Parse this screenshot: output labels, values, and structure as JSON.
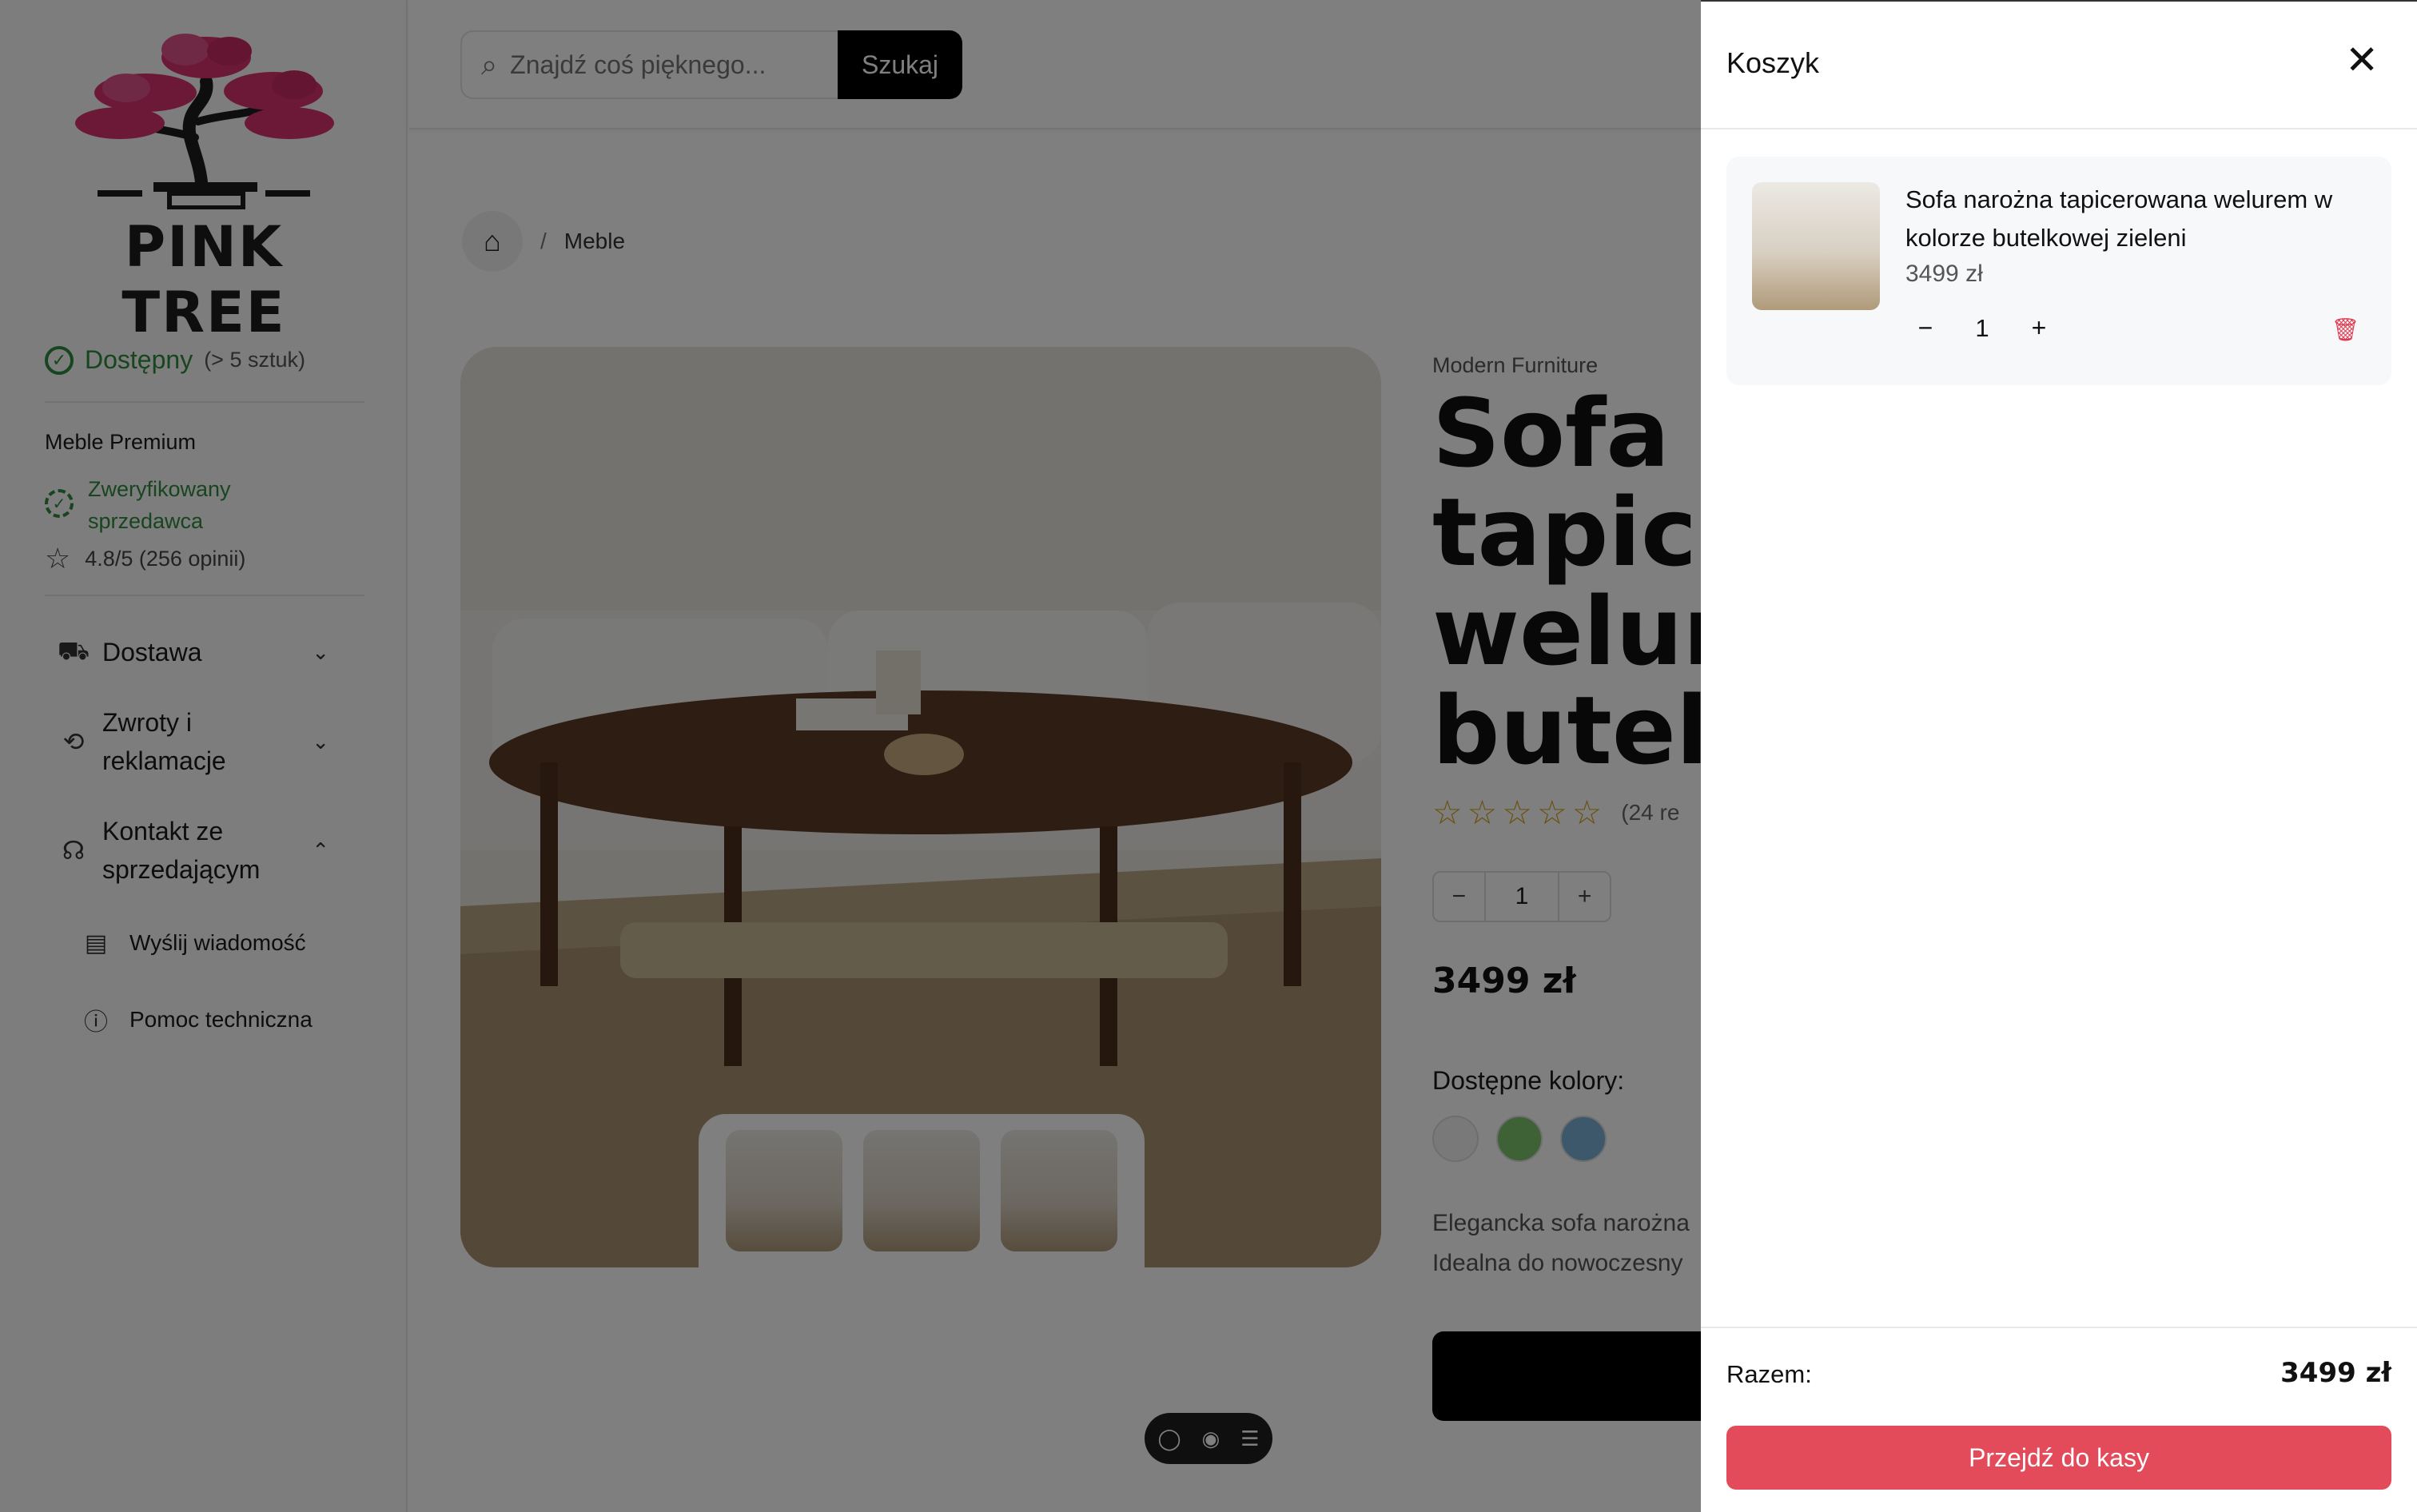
{
  "brand": {
    "logo_text": "PINK TREE"
  },
  "search": {
    "placeholder": "Znajdź coś pięknego...",
    "button_label": "Szukaj"
  },
  "breadcrumb": {
    "separator": "/",
    "current": "Meble"
  },
  "sidebar": {
    "availability": {
      "label": "Dostępny",
      "detail": "(> 5 sztuk)"
    },
    "seller": {
      "name": "Meble Premium",
      "verified_label": "Zweryfikowany sprzedawca",
      "rating": "4.8/5 (256 opinii)"
    },
    "accordion": [
      {
        "label": "Dostawa",
        "icon": "truck-icon",
        "expanded": false
      },
      {
        "label": "Zwroty i reklamacje",
        "icon": "returns-icon",
        "expanded": false
      },
      {
        "label": "Kontakt ze sprzedającym",
        "icon": "headset-icon",
        "expanded": true
      }
    ],
    "contact_items": [
      {
        "label": "Wyślij wiadomość",
        "icon": "message-icon"
      },
      {
        "label": "Pomoc techniczna",
        "icon": "help-icon"
      }
    ]
  },
  "product": {
    "brand": "Modern Furniture",
    "title_visible": "Sofa n\ntapice\nwelur\nbutelk",
    "reviews_visible": "(24 re",
    "quantity": "1",
    "price": "3499 zł",
    "colors_label": "Dostępne kolory:",
    "colors": [
      "#f2f2f2",
      "#7cc26a",
      "#7aaed6"
    ],
    "description_visible": "Elegancka sofa narożna\nIdealna do nowoczesny",
    "rating_stars": 5
  },
  "cart": {
    "title": "Koszyk",
    "items": [
      {
        "name": "Sofa narożna tapicerowana welurem w kolorze butelkowej zieleni",
        "price": "3499 zł",
        "quantity": "1"
      }
    ],
    "total_label": "Razem:",
    "total_value": "3499 zł",
    "checkout_label": "Przejdź do kasy"
  },
  "colors": {
    "accent": "#e34a5a",
    "success": "#2e8b3e",
    "star": "#d4a017",
    "logo_pink": "#d6336c"
  }
}
